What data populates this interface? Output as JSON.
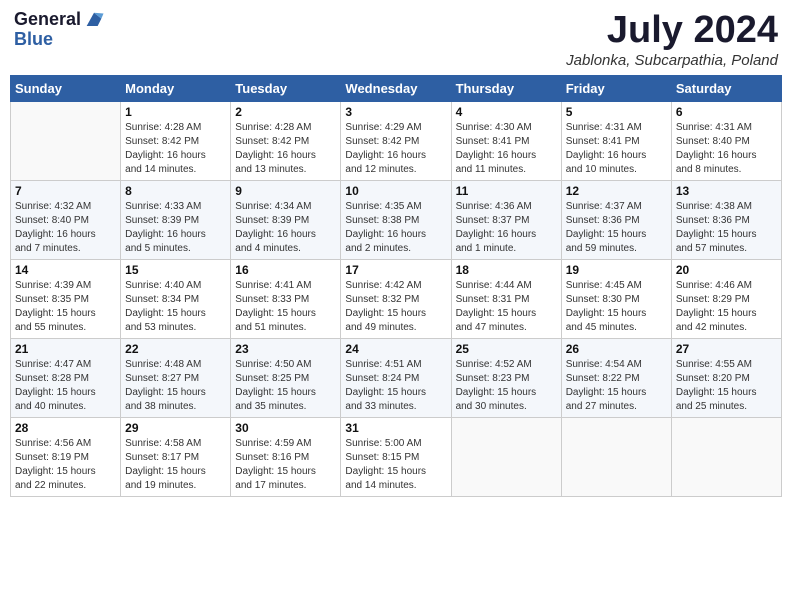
{
  "header": {
    "logo_line1": "General",
    "logo_line2": "Blue",
    "title": "July 2024",
    "subtitle": "Jablonka, Subcarpathia, Poland"
  },
  "weekdays": [
    "Sunday",
    "Monday",
    "Tuesday",
    "Wednesday",
    "Thursday",
    "Friday",
    "Saturday"
  ],
  "weeks": [
    [
      {
        "day": "",
        "info": ""
      },
      {
        "day": "1",
        "info": "Sunrise: 4:28 AM\nSunset: 8:42 PM\nDaylight: 16 hours\nand 14 minutes."
      },
      {
        "day": "2",
        "info": "Sunrise: 4:28 AM\nSunset: 8:42 PM\nDaylight: 16 hours\nand 13 minutes."
      },
      {
        "day": "3",
        "info": "Sunrise: 4:29 AM\nSunset: 8:42 PM\nDaylight: 16 hours\nand 12 minutes."
      },
      {
        "day": "4",
        "info": "Sunrise: 4:30 AM\nSunset: 8:41 PM\nDaylight: 16 hours\nand 11 minutes."
      },
      {
        "day": "5",
        "info": "Sunrise: 4:31 AM\nSunset: 8:41 PM\nDaylight: 16 hours\nand 10 minutes."
      },
      {
        "day": "6",
        "info": "Sunrise: 4:31 AM\nSunset: 8:40 PM\nDaylight: 16 hours\nand 8 minutes."
      }
    ],
    [
      {
        "day": "7",
        "info": "Sunrise: 4:32 AM\nSunset: 8:40 PM\nDaylight: 16 hours\nand 7 minutes."
      },
      {
        "day": "8",
        "info": "Sunrise: 4:33 AM\nSunset: 8:39 PM\nDaylight: 16 hours\nand 5 minutes."
      },
      {
        "day": "9",
        "info": "Sunrise: 4:34 AM\nSunset: 8:39 PM\nDaylight: 16 hours\nand 4 minutes."
      },
      {
        "day": "10",
        "info": "Sunrise: 4:35 AM\nSunset: 8:38 PM\nDaylight: 16 hours\nand 2 minutes."
      },
      {
        "day": "11",
        "info": "Sunrise: 4:36 AM\nSunset: 8:37 PM\nDaylight: 16 hours\nand 1 minute."
      },
      {
        "day": "12",
        "info": "Sunrise: 4:37 AM\nSunset: 8:36 PM\nDaylight: 15 hours\nand 59 minutes."
      },
      {
        "day": "13",
        "info": "Sunrise: 4:38 AM\nSunset: 8:36 PM\nDaylight: 15 hours\nand 57 minutes."
      }
    ],
    [
      {
        "day": "14",
        "info": "Sunrise: 4:39 AM\nSunset: 8:35 PM\nDaylight: 15 hours\nand 55 minutes."
      },
      {
        "day": "15",
        "info": "Sunrise: 4:40 AM\nSunset: 8:34 PM\nDaylight: 15 hours\nand 53 minutes."
      },
      {
        "day": "16",
        "info": "Sunrise: 4:41 AM\nSunset: 8:33 PM\nDaylight: 15 hours\nand 51 minutes."
      },
      {
        "day": "17",
        "info": "Sunrise: 4:42 AM\nSunset: 8:32 PM\nDaylight: 15 hours\nand 49 minutes."
      },
      {
        "day": "18",
        "info": "Sunrise: 4:44 AM\nSunset: 8:31 PM\nDaylight: 15 hours\nand 47 minutes."
      },
      {
        "day": "19",
        "info": "Sunrise: 4:45 AM\nSunset: 8:30 PM\nDaylight: 15 hours\nand 45 minutes."
      },
      {
        "day": "20",
        "info": "Sunrise: 4:46 AM\nSunset: 8:29 PM\nDaylight: 15 hours\nand 42 minutes."
      }
    ],
    [
      {
        "day": "21",
        "info": "Sunrise: 4:47 AM\nSunset: 8:28 PM\nDaylight: 15 hours\nand 40 minutes."
      },
      {
        "day": "22",
        "info": "Sunrise: 4:48 AM\nSunset: 8:27 PM\nDaylight: 15 hours\nand 38 minutes."
      },
      {
        "day": "23",
        "info": "Sunrise: 4:50 AM\nSunset: 8:25 PM\nDaylight: 15 hours\nand 35 minutes."
      },
      {
        "day": "24",
        "info": "Sunrise: 4:51 AM\nSunset: 8:24 PM\nDaylight: 15 hours\nand 33 minutes."
      },
      {
        "day": "25",
        "info": "Sunrise: 4:52 AM\nSunset: 8:23 PM\nDaylight: 15 hours\nand 30 minutes."
      },
      {
        "day": "26",
        "info": "Sunrise: 4:54 AM\nSunset: 8:22 PM\nDaylight: 15 hours\nand 27 minutes."
      },
      {
        "day": "27",
        "info": "Sunrise: 4:55 AM\nSunset: 8:20 PM\nDaylight: 15 hours\nand 25 minutes."
      }
    ],
    [
      {
        "day": "28",
        "info": "Sunrise: 4:56 AM\nSunset: 8:19 PM\nDaylight: 15 hours\nand 22 minutes."
      },
      {
        "day": "29",
        "info": "Sunrise: 4:58 AM\nSunset: 8:17 PM\nDaylight: 15 hours\nand 19 minutes."
      },
      {
        "day": "30",
        "info": "Sunrise: 4:59 AM\nSunset: 8:16 PM\nDaylight: 15 hours\nand 17 minutes."
      },
      {
        "day": "31",
        "info": "Sunrise: 5:00 AM\nSunset: 8:15 PM\nDaylight: 15 hours\nand 14 minutes."
      },
      {
        "day": "",
        "info": ""
      },
      {
        "day": "",
        "info": ""
      },
      {
        "day": "",
        "info": ""
      }
    ]
  ]
}
